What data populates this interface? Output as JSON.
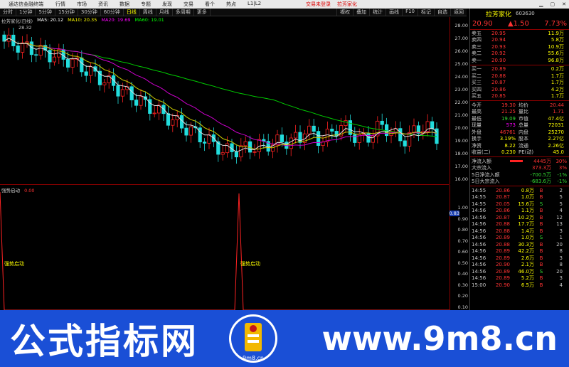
{
  "app": {
    "name": "通达信金融终端",
    "menu": [
      "行情",
      "市场",
      "资讯",
      "数据",
      "专题",
      "发现",
      "交易",
      "看个",
      "热点",
      "L1|L2"
    ],
    "promo": "交易未登录",
    "promo2": "拉芳家化",
    "clock": "16:30:17"
  },
  "periods": [
    "分时",
    "1分钟",
    "5分钟",
    "15分钟",
    "30分钟",
    "60分钟",
    "日线",
    "周线",
    "月线",
    "多周期",
    "更多"
  ],
  "active_period": "日线",
  "tools": [
    "複权",
    "叠加",
    "统计",
    "画线",
    "F10",
    "标记",
    "自选",
    "返回"
  ],
  "ma": {
    "title": "拉芳家化(日线)",
    "ma5": "MA5: 20.12",
    "ma10": "MA10: 20.35",
    "ma20": "MA20: 19.69",
    "ma60": "MA60: 19.01",
    "high_note": "28.32",
    "colors": {
      "ma5": "#ffffff",
      "ma10": "#ffff00",
      "ma20": "#ff00ff",
      "ma60": "#00ff00"
    }
  },
  "main_axis": [
    "28.00",
    "27.00",
    "26.00",
    "25.00",
    "24.00",
    "23.00",
    "22.00",
    "21.00",
    "20.00",
    "19.00",
    "18.00",
    "17.00",
    "16.00"
  ],
  "indicator": {
    "title": "强势启动",
    "value": "0.00",
    "signal_label": "强势启动",
    "axis": [
      "1.00",
      "0.90",
      "0.80",
      "0.70",
      "0.60",
      "0.50",
      "0.40",
      "0.30",
      "0.20",
      "0.10"
    ],
    "current": "0.83"
  },
  "stock": {
    "name": "拉芳家化",
    "code": "603630",
    "price": "20.90",
    "change": "▲1.50",
    "pct": "7.73%"
  },
  "asks": [
    {
      "label": "卖五",
      "price": "20.95",
      "vol": "11.9万"
    },
    {
      "label": "卖四",
      "price": "20.94",
      "vol": "5.8万"
    },
    {
      "label": "卖三",
      "price": "20.93",
      "vol": "10.9万"
    },
    {
      "label": "卖二",
      "price": "20.92",
      "vol": "55.6万"
    },
    {
      "label": "卖一",
      "price": "20.90",
      "vol": "96.8万"
    }
  ],
  "bids": [
    {
      "label": "买一",
      "price": "20.89",
      "vol": "0.2万"
    },
    {
      "label": "买二",
      "price": "20.88",
      "vol": "1.7万"
    },
    {
      "label": "买三",
      "price": "20.87",
      "vol": "1.7万"
    },
    {
      "label": "买四",
      "price": "20.86",
      "vol": "4.2万"
    },
    {
      "label": "买五",
      "price": "20.85",
      "vol": "1.7万"
    }
  ],
  "quote": [
    {
      "k1": "今开",
      "v1": "19.30",
      "k2": "均价",
      "v2": "20.44",
      "c1": "#ff3333"
    },
    {
      "k1": "最高",
      "v1": "21.25",
      "k2": "量比",
      "v2": "1.71",
      "c1": "#ff3333"
    },
    {
      "k1": "最低",
      "v1": "19.09",
      "k2": "市值",
      "v2": "47.4亿",
      "c1": "#33dd33"
    },
    {
      "k1": "现量",
      "v1": "573",
      "k2": "总量",
      "v2": "72031",
      "c1": "#ff00ff"
    },
    {
      "k1": "外盘",
      "v1": "46761",
      "k2": "内盘",
      "v2": "25270",
      "c1": "#ff3333"
    },
    {
      "k1": "换手",
      "v1": "3.19%",
      "k2": "股本",
      "v2": "2.27亿",
      "c1": "#ffff00"
    },
    {
      "k1": "净资",
      "v1": "8.22",
      "k2": "流通",
      "v2": "2.26亿",
      "c1": "#ffff00"
    },
    {
      "k1": "收益(二)",
      "v1": "0.230",
      "k2": "PE(动)",
      "v2": "45.0",
      "c1": "#ffff00"
    }
  ],
  "flows": [
    {
      "k": "净流入额",
      "v": "4445万",
      "p": "30%"
    },
    {
      "k": "大宗流入",
      "v": "373.3万",
      "p": "3%"
    },
    {
      "k": "5日净流入额",
      "v": "-700.5万",
      "p": "-1%"
    },
    {
      "k": "5日大宗流入",
      "v": "-683.6万",
      "p": "-1%"
    }
  ],
  "ticks": [
    {
      "t": "14:55",
      "p": "20.86",
      "v": "0.8万",
      "d": "B",
      "c": "2"
    },
    {
      "t": "14:55",
      "p": "20.87",
      "v": "1.0万",
      "d": "B",
      "c": "5"
    },
    {
      "t": "14:55",
      "p": "20.05",
      "v": "15.6万",
      "d": "S",
      "c": "5"
    },
    {
      "t": "14:56",
      "p": "20.86",
      "v": "1.1万",
      "d": "B",
      "c": "4"
    },
    {
      "t": "14:56",
      "p": "20.87",
      "v": "10.2万",
      "d": "B",
      "c": "12"
    },
    {
      "t": "14:56",
      "p": "20.88",
      "v": "17.7万",
      "d": "B",
      "c": "13"
    },
    {
      "t": "14:56",
      "p": "20.88",
      "v": "1.4万",
      "d": "B",
      "c": "3"
    },
    {
      "t": "14:56",
      "p": "20.89",
      "v": "1.0万",
      "d": "S",
      "c": "1"
    },
    {
      "t": "14:56",
      "p": "20.88",
      "v": "30.3万",
      "d": "B",
      "c": "20"
    },
    {
      "t": "14:56",
      "p": "20.89",
      "v": "42.2万",
      "d": "B",
      "c": "8"
    },
    {
      "t": "14:56",
      "p": "20.89",
      "v": "2.6万",
      "d": "B",
      "c": "3"
    },
    {
      "t": "14:56",
      "p": "20.90",
      "v": "2.1万",
      "d": "B",
      "c": "8"
    },
    {
      "t": "14:56",
      "p": "20.89",
      "v": "46.0万",
      "d": "S",
      "c": "20"
    },
    {
      "t": "14:56",
      "p": "20.89",
      "v": "5.2万",
      "d": "B",
      "c": "3"
    },
    {
      "t": "15:00",
      "p": "20.90",
      "v": "6.5万",
      "d": "B",
      "c": "4"
    }
  ],
  "banner": {
    "cn": "公式指标网",
    "url": "www.9m8.cn",
    "logo_text": "9m8.cn"
  }
}
